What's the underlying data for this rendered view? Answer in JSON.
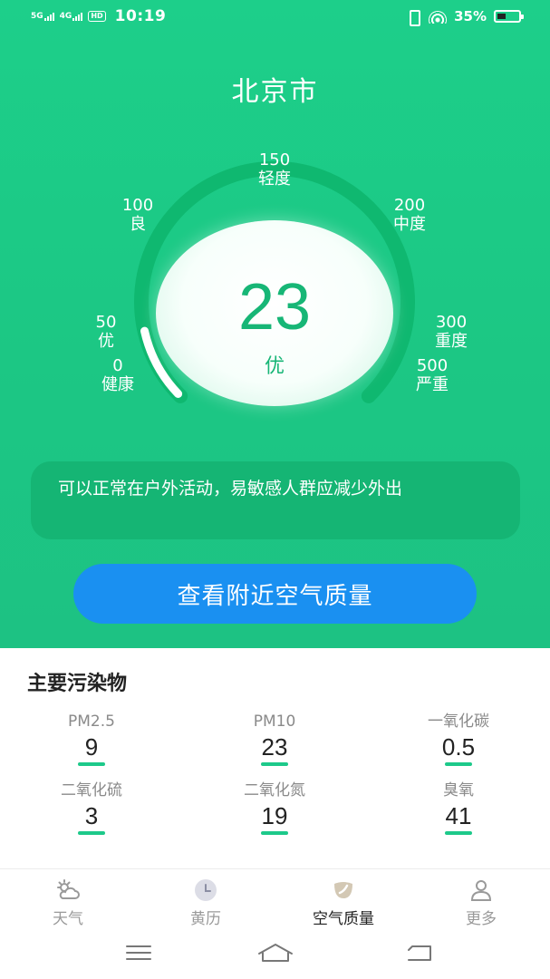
{
  "status_bar": {
    "network_1": "5G",
    "network_2": "4G",
    "hd_badge": "HD",
    "time": "10:19",
    "battery": "35%"
  },
  "city": "北京市",
  "gauge": {
    "aqi": "23",
    "level": "优",
    "aqi_fraction": 0.046,
    "scale": [
      {
        "value": "0",
        "label": "健康"
      },
      {
        "value": "50",
        "label": "优"
      },
      {
        "value": "100",
        "label": "良"
      },
      {
        "value": "150",
        "label": "轻度"
      },
      {
        "value": "200",
        "label": "中度"
      },
      {
        "value": "300",
        "label": "重度"
      },
      {
        "value": "500",
        "label": "严重"
      }
    ],
    "colors": {
      "arc_track": "#0fb870",
      "arc_fill": "#ffffff",
      "value_text": "#17b676"
    }
  },
  "advice": "可以正常在户外活动，易敏感人群应减少外出",
  "nearby_button": "查看附近空气质量",
  "pollutants": {
    "title": "主要污染物",
    "items": [
      {
        "name": "PM2.5",
        "value": "9"
      },
      {
        "name": "PM10",
        "value": "23"
      },
      {
        "name": "一氧化碳",
        "value": "0.5"
      },
      {
        "name": "二氧化硫",
        "value": "3"
      },
      {
        "name": "二氧化氮",
        "value": "19"
      },
      {
        "name": "臭氧",
        "value": "41"
      }
    ]
  },
  "tabs": [
    {
      "label": "天气",
      "icon": "weather-icon"
    },
    {
      "label": "黄历",
      "icon": "clock-icon"
    },
    {
      "label": "空气质量",
      "icon": "leaf-icon",
      "active": true
    },
    {
      "label": "更多",
      "icon": "person-icon"
    }
  ],
  "colors": {
    "brand_green": "#1dcf8a",
    "button_blue": "#1a90f1",
    "accent_bar": "#1dc98a"
  }
}
